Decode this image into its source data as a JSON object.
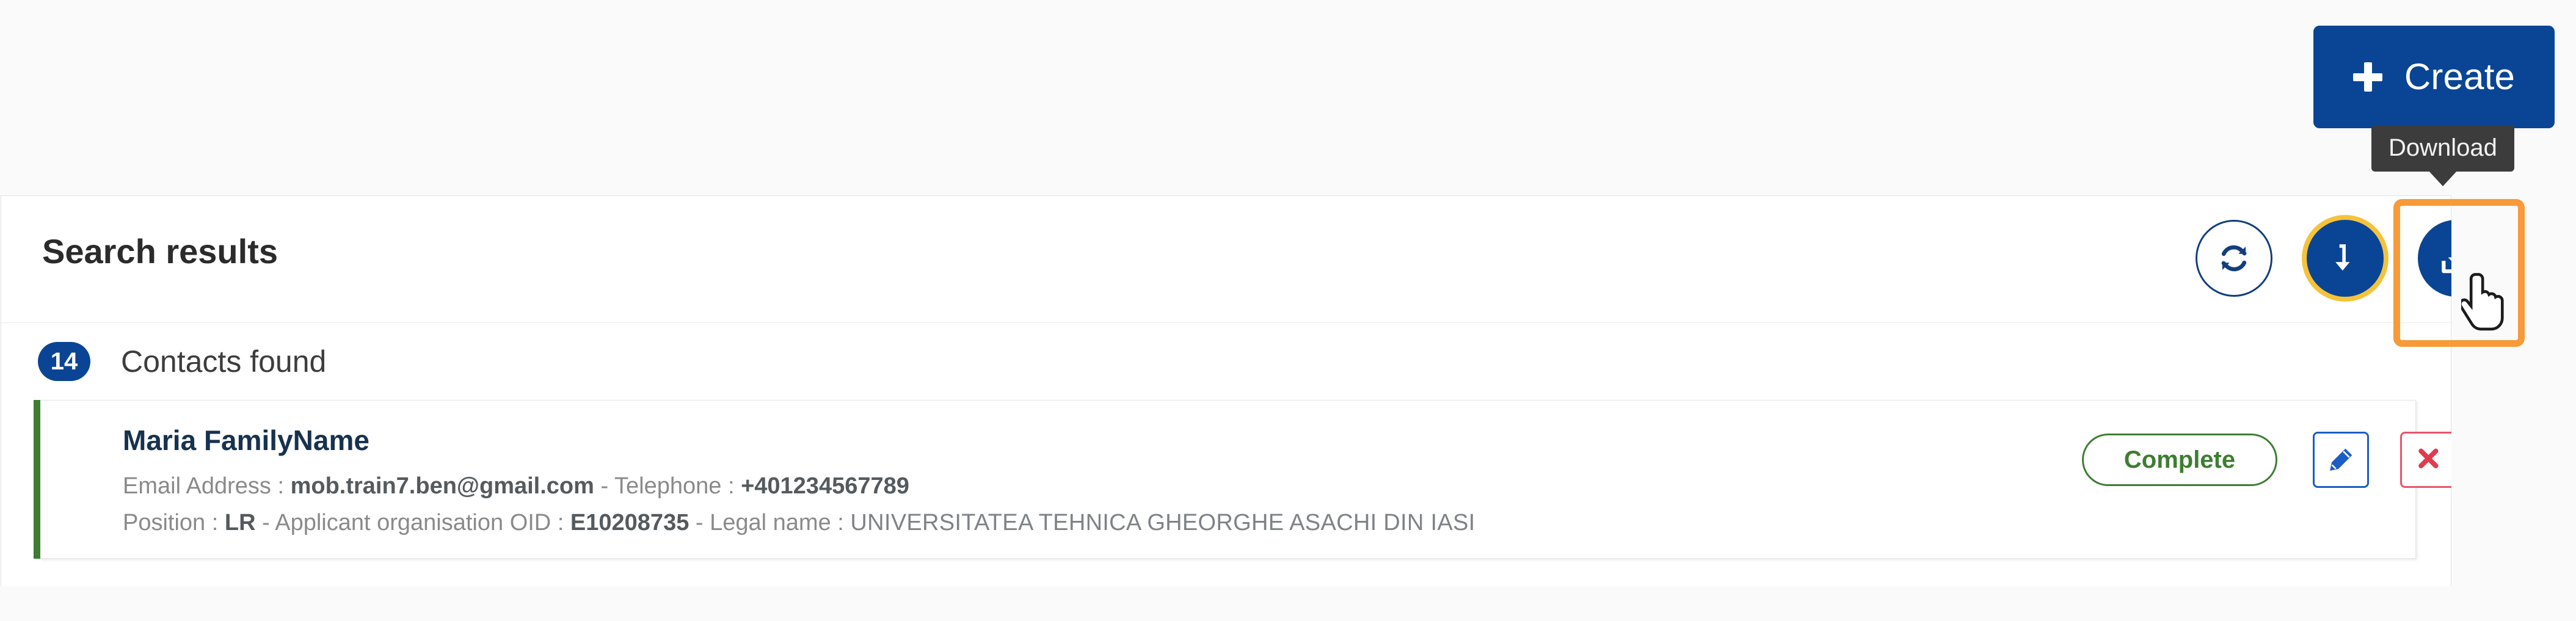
{
  "topbar": {
    "create_button": {
      "label": "Create",
      "icon": "plus-icon",
      "bg_color": "#0a4595",
      "text_color": "#ffffff"
    }
  },
  "tooltip": {
    "text": "Download",
    "bg_color": "#3c3c3c",
    "text_color": "#f2f2f2"
  },
  "panel": {
    "title": "Search results",
    "actions": [
      {
        "name": "refresh",
        "icon": "refresh-icon",
        "style": "outline",
        "color": "#123f7c"
      },
      {
        "name": "sort",
        "icon": "arrow-down-icon",
        "style": "filled",
        "color": "#0a4595",
        "focus_ring": "#f5c33b"
      },
      {
        "name": "download",
        "icon": "download-tray-icon",
        "style": "filled",
        "color": "#0a4595",
        "highlight_box": "#f79a38"
      }
    ],
    "results": {
      "count": "14",
      "label": "Contacts found"
    }
  },
  "contact": {
    "name": "Maria FamilyName",
    "accent_color": "#3e7d32",
    "line1": {
      "email_label": "Email Address : ",
      "email_value": "mob.train7.ben@gmail.com",
      "separator": " - ",
      "phone_label": "Telephone : ",
      "phone_value": "+401234567789"
    },
    "line2": {
      "position_label": "Position : ",
      "position_value": "LR",
      "separator1": " - ",
      "oid_label": "Applicant organisation OID : ",
      "oid_value": "E10208735",
      "separator2": " - ",
      "legal_label": "Legal name : ",
      "legal_value": "UNIVERSITATEA TEHNICA GHEORGHE ASACHI DIN IASI"
    },
    "status": {
      "label": "Complete",
      "color": "#3e7d32"
    },
    "row_actions": [
      {
        "name": "edit",
        "icon": "pencil-icon",
        "color": "#1a5ec4"
      },
      {
        "name": "delete",
        "icon": "x-icon",
        "color": "#e8546a"
      },
      {
        "name": "expand",
        "icon": "chevron-down-icon",
        "color": "#6e7276"
      }
    ]
  }
}
